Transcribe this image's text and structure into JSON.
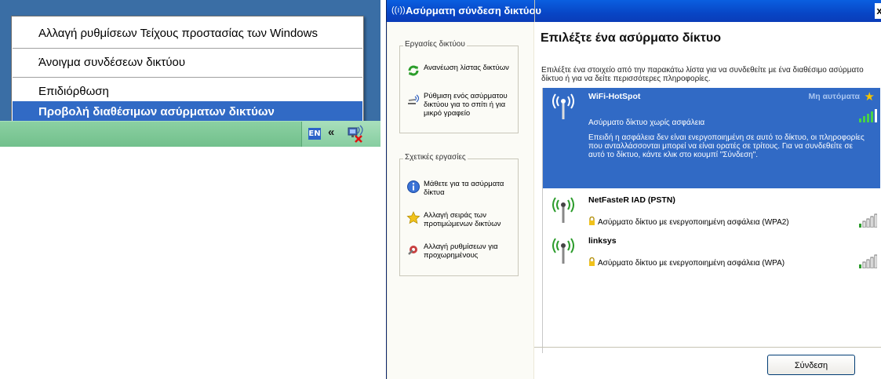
{
  "context_menu": {
    "items": [
      {
        "label": "Αλλαγή  ρυθμίσεων Τείχους προστασίας των Windows"
      },
      {
        "label": "Άνοιγμα συνδέσεων δικτύου"
      },
      {
        "label": "Επιδιόρθωση"
      },
      {
        "label": "Προβολή διαθέσιμων ασύρματων δικτύων",
        "highlighted": true
      }
    ]
  },
  "tray": {
    "language": "EN",
    "chevron": "«",
    "icon": "network-disconnected-icon"
  },
  "dialog": {
    "title": "Ασύρματη σύνδεση δικτύου",
    "close": "x",
    "sidebar": {
      "network_tasks": {
        "title": "Εργασίες δικτύου",
        "items": [
          {
            "label": "Ανανέωση λίστας δικτύων",
            "icon": "refresh-icon"
          },
          {
            "label": "Ρύθμιση ενός ασύρματου δικτύου για το σπίτι ή για μικρό γραφείο",
            "icon": "wireless-setup-icon"
          }
        ]
      },
      "related_tasks": {
        "title": "Σχετικές εργασίες",
        "items": [
          {
            "label": "Μάθετε για τα ασύρματα δίκτυα",
            "icon": "info-icon"
          },
          {
            "label": "Αλλαγή σειράς των προτιμώμενων δικτύων",
            "icon": "star-icon"
          },
          {
            "label": "Αλλαγή ρυθμίσεων για προχωρημένους",
            "icon": "settings-icon"
          }
        ]
      }
    },
    "main": {
      "heading": "Επιλέξτε ένα ασύρματο δίκτυο",
      "instructions": "Επιλέξτε ένα στοιχείο από την παρακάτω λίστα για να συνδεθείτε με ένα διαθέσιμο ασύρματο δίκτυο ή για να δείτε περισσότερες πληροφορίες.",
      "networks": [
        {
          "name": "WiFi-HotSpot",
          "auto": "Μη αυτόματα",
          "security": "Ασύρματο δίκτυο χωρίς ασφάλεια",
          "description": "Επειδή η ασφάλεια δεν είναι ενεργοποιημένη σε αυτό το δίκτυο, οι πληροφορίες που ανταλλάσσονται μπορεί να είναι ορατές σε τρίτους. Για να συνδεθείτε σε αυτό το δίκτυο, κάντε κλικ στο κουμπί \"Σύνδεση\".",
          "signal": 4,
          "selected": true
        },
        {
          "name": "NetFasteR IAD (PSTN)",
          "security": "Ασύρματο δίκτυο με ενεργοποιημένη ασφάλεια (WPA2)",
          "signal": 1
        },
        {
          "name": "linksys",
          "security": "Ασύρματο δίκτυο με ενεργοποιημένη ασφάλεια (WPA)",
          "signal": 1
        }
      ],
      "connect_button": "Σύνδεση"
    }
  },
  "colors": {
    "selection": "#316ac5",
    "titlebar": "#0a5fe0",
    "desktop": "#3a6ea5",
    "taskbar": "#7cc596"
  }
}
